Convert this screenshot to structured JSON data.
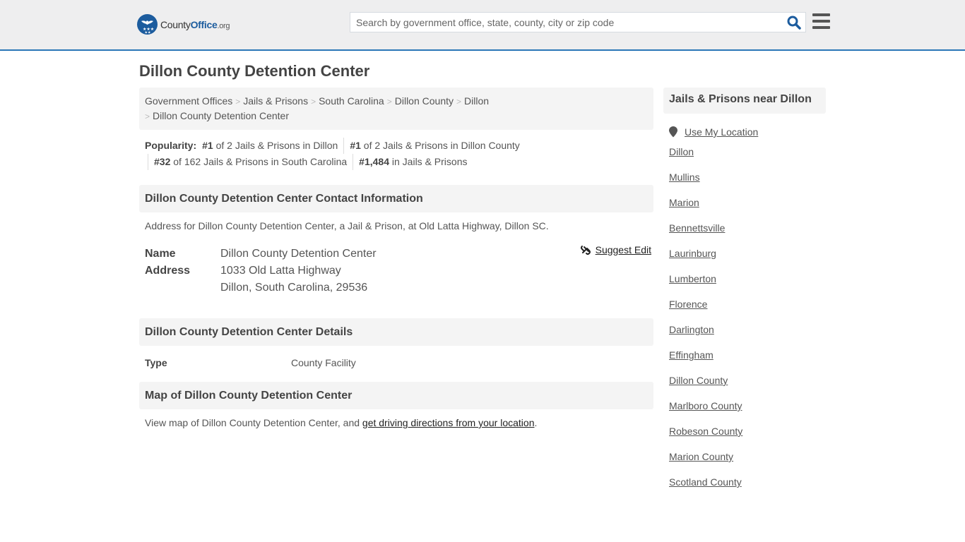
{
  "header": {
    "logo": {
      "name": "County",
      "bold": "Office",
      "tld": ".org"
    },
    "search": {
      "placeholder": "Search by government office, state, county, city or zip code",
      "value": ""
    },
    "colors": {
      "brand": "#1c5c9e",
      "accent_border": "#2b77b7"
    }
  },
  "page": {
    "title": "Dillon County Detention Center"
  },
  "breadcrumb": [
    "Government Offices",
    "Jails & Prisons",
    "South Carolina",
    "Dillon County",
    "Dillon",
    "Dillon County Detention Center"
  ],
  "popularity": {
    "label": "Popularity:",
    "items": [
      {
        "rank": "#1",
        "text": " of 2 Jails & Prisons in Dillon"
      },
      {
        "rank": "#1",
        "text": " of 2 Jails & Prisons in Dillon County"
      },
      {
        "rank": "#32",
        "text": " of 162 Jails & Prisons in South Carolina"
      },
      {
        "rank": "#1,484",
        "text": " in Jails & Prisons"
      }
    ]
  },
  "contact": {
    "heading": "Dillon County Detention Center Contact Information",
    "description": "Address for Dillon County Detention Center, a Jail & Prison, at Old Latta Highway, Dillon SC.",
    "suggest_edit": "Suggest Edit",
    "fields": {
      "name_label": "Name",
      "name_value": "Dillon County Detention Center",
      "address_label": "Address",
      "address_line1": "1033 Old Latta Highway",
      "address_line2": "Dillon, South Carolina, 29536"
    }
  },
  "details": {
    "heading": "Dillon County Detention Center Details",
    "type_label": "Type",
    "type_value": "County Facility"
  },
  "map": {
    "heading": "Map of Dillon County Detention Center",
    "text_before": "View map of Dillon County Detention Center, and ",
    "link": "get driving directions from your location",
    "text_after": "."
  },
  "sidebar": {
    "heading": "Jails & Prisons near Dillon",
    "use_location": "Use My Location",
    "cities": [
      "Dillon",
      "Mullins",
      "Marion",
      "Bennettsville",
      "Laurinburg",
      "Lumberton",
      "Florence",
      "Darlington",
      "Effingham",
      "Dillon County",
      "Marlboro County",
      "Robeson County",
      "Marion County",
      "Scotland County"
    ]
  }
}
